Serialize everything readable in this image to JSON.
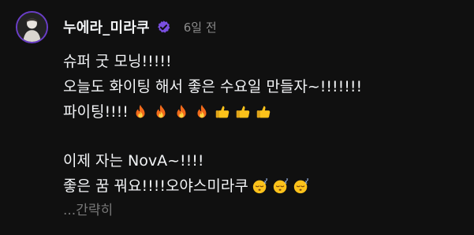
{
  "post": {
    "username": "누에라_미라쿠",
    "verified": true,
    "timestamp": "6일 전",
    "accent_color": "#7a4fe0",
    "lines": {
      "l1": "슈퍼 굿 모닝!!!!!",
      "l2": "오늘도 화이팅 해서 좋은 수요일 만들자~!!!!!!!",
      "l3": "파이팅!!!!",
      "l4": "이제 자는 NovA~!!!!",
      "l5": "좋은 꿈 꿔요!!!!오야스미라쿠"
    },
    "line3_emojis": [
      "fire-icon",
      "fire-icon",
      "fire-icon",
      "fire-icon",
      "thumbs-up-icon",
      "thumbs-up-icon",
      "thumbs-up-icon"
    ],
    "line5_emojis": [
      "sleeping-face-icon",
      "sleeping-face-icon",
      "sleeping-face-icon"
    ],
    "more_label": "...간략히"
  }
}
